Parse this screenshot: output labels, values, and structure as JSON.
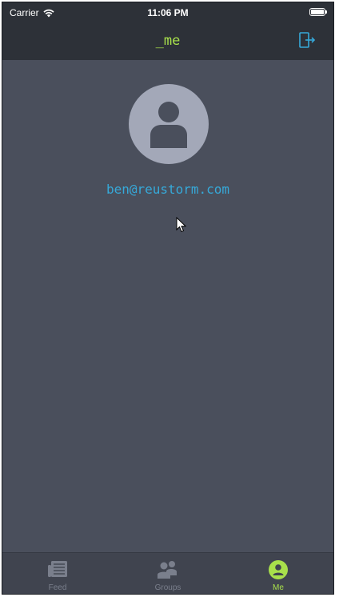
{
  "status_bar": {
    "carrier": "Carrier",
    "time": "11:06 PM",
    "icons": [
      "wifi-icon",
      "battery-icon"
    ]
  },
  "nav": {
    "title": "_me",
    "right_icon": "logout-icon"
  },
  "profile": {
    "avatar_icon": "user-icon",
    "email": "ben@reustorm.com"
  },
  "tabs": [
    {
      "label": "Feed",
      "icon": "newspaper-icon",
      "active": false
    },
    {
      "label": "Groups",
      "icon": "groups-icon",
      "active": false
    },
    {
      "label": "Me",
      "icon": "user-circle-icon",
      "active": true
    }
  ],
  "colors": {
    "bar_background": "#2d3138",
    "content_background": "#4a4f5c",
    "accent_green": "#a8e04b",
    "accent_blue": "#36a9d9",
    "avatar": "#a3a8b8"
  }
}
